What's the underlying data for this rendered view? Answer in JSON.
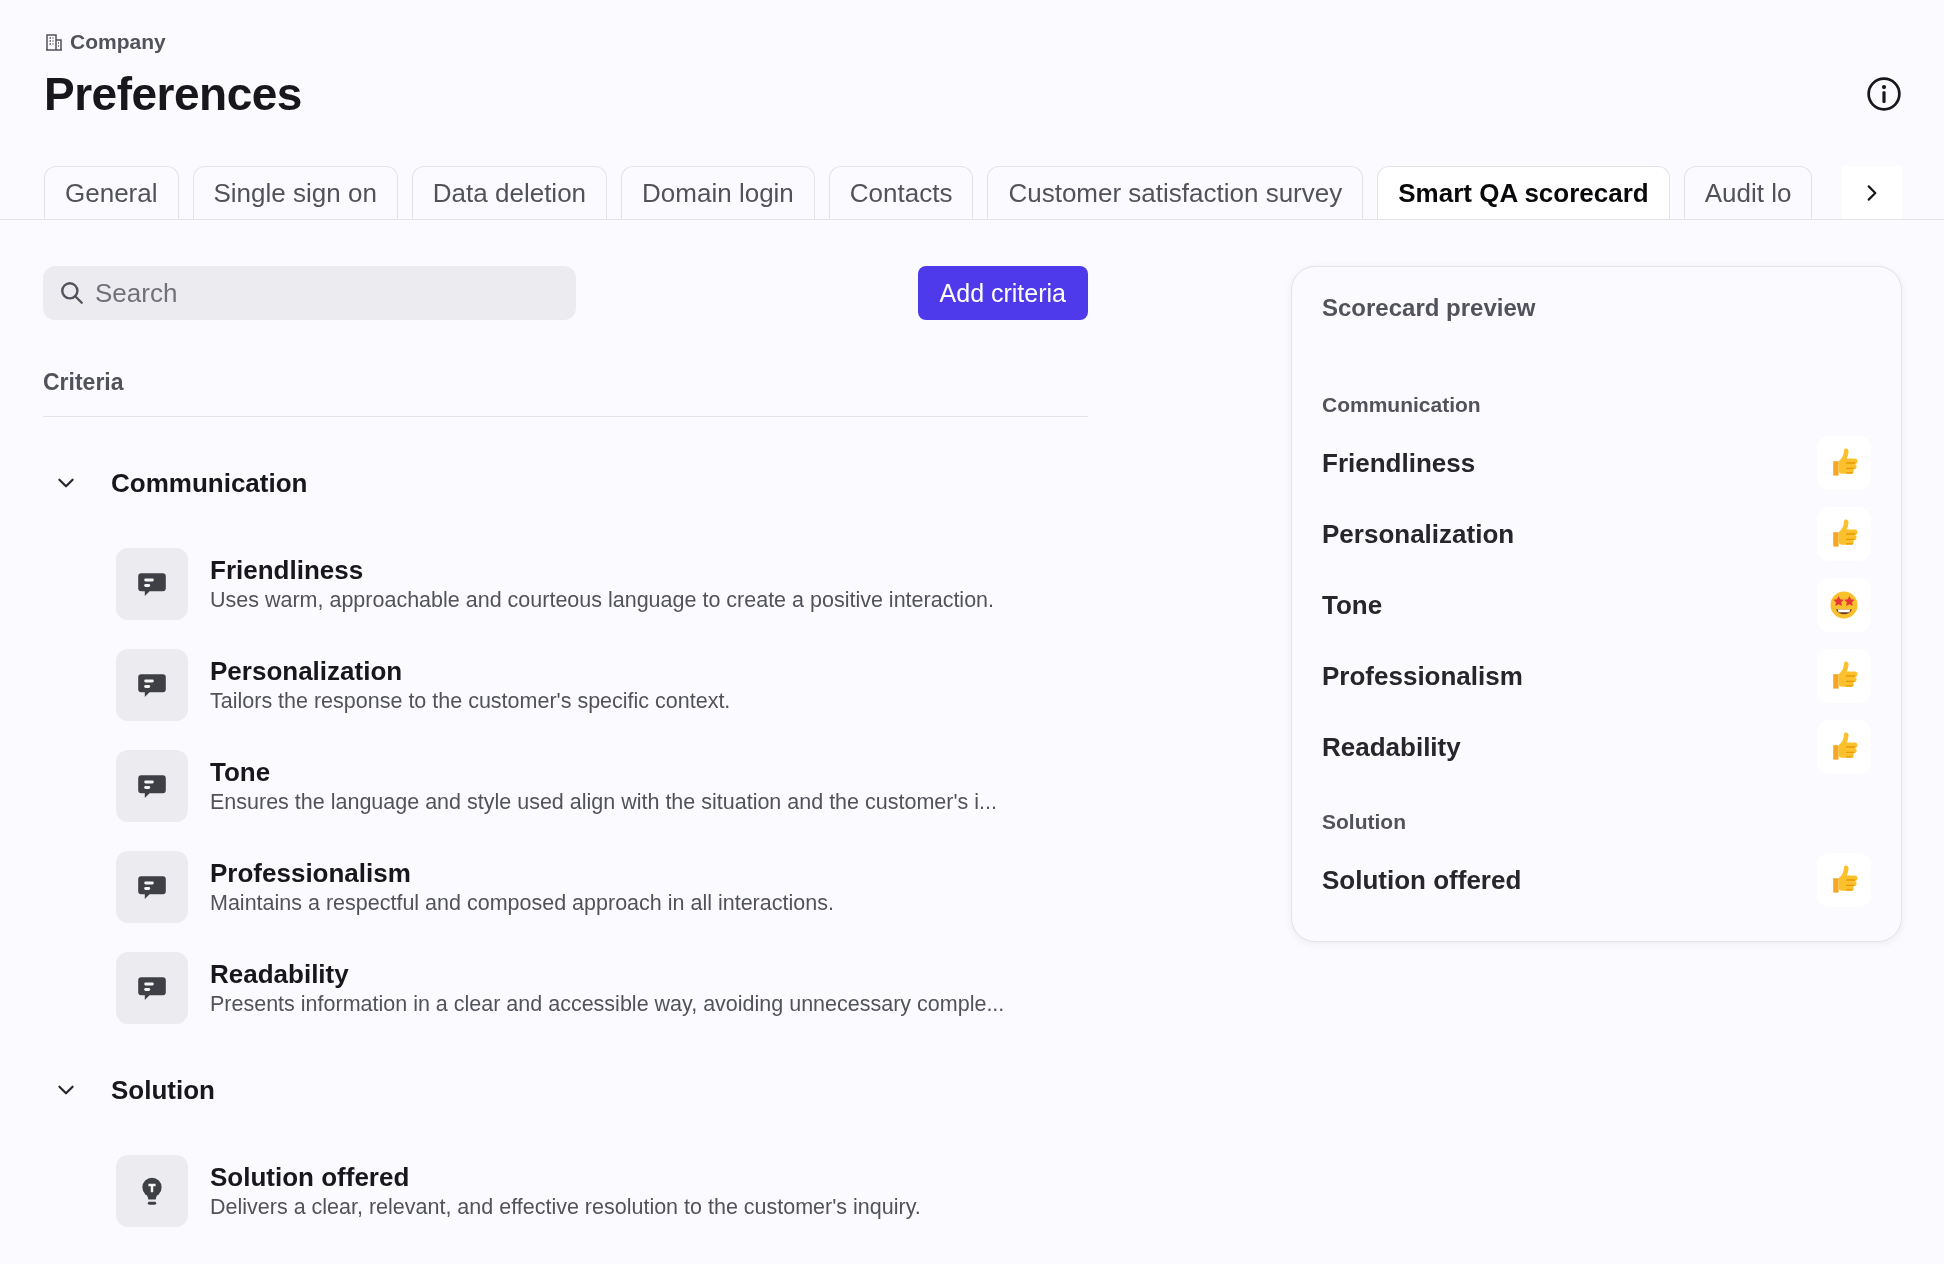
{
  "breadcrumb": "Company",
  "title": "Preferences",
  "tabs": [
    {
      "label": "General",
      "selected": false
    },
    {
      "label": "Single sign on",
      "selected": false
    },
    {
      "label": "Data deletion",
      "selected": false
    },
    {
      "label": "Domain login",
      "selected": false
    },
    {
      "label": "Contacts",
      "selected": false
    },
    {
      "label": "Customer satisfaction survey",
      "selected": false
    },
    {
      "label": "Smart QA scorecard",
      "selected": true
    },
    {
      "label": "Audit lo",
      "selected": false
    }
  ],
  "search": {
    "placeholder": "Search"
  },
  "add_button": "Add criteria",
  "criteria_heading": "Criteria",
  "groups": [
    {
      "name": "Communication",
      "expanded": true,
      "items": [
        {
          "kind": "chat",
          "title": "Friendliness",
          "description": "Uses warm, approachable and courteous language to create a positive interaction."
        },
        {
          "kind": "chat",
          "title": "Personalization",
          "description": "Tailors the response to the customer's specific context."
        },
        {
          "kind": "chat",
          "title": "Tone",
          "description": "Ensures the language and style used align with the situation and the customer's i..."
        },
        {
          "kind": "chat",
          "title": "Professionalism",
          "description": "Maintains a respectful and composed approach in all interactions."
        },
        {
          "kind": "chat",
          "title": "Readability",
          "description": "Presents information in a clear and accessible way, avoiding unnecessary comple..."
        }
      ]
    },
    {
      "name": "Solution",
      "expanded": true,
      "items": [
        {
          "kind": "bulb",
          "title": "Solution offered",
          "description": "Delivers a clear, relevant, and effective resolution to the customer's inquiry."
        }
      ]
    }
  ],
  "preview": {
    "title": "Scorecard preview",
    "groups": [
      {
        "name": "Communication",
        "items": [
          {
            "label": "Friendliness",
            "kind": "thumbs_up"
          },
          {
            "label": "Personalization",
            "kind": "thumbs_up"
          },
          {
            "label": "Tone",
            "kind": "star_eyes"
          },
          {
            "label": "Professionalism",
            "kind": "thumbs_up"
          },
          {
            "label": "Readability",
            "kind": "thumbs_up"
          }
        ]
      },
      {
        "name": "Solution",
        "items": [
          {
            "label": "Solution offered",
            "kind": "thumbs_up"
          }
        ]
      }
    ]
  }
}
